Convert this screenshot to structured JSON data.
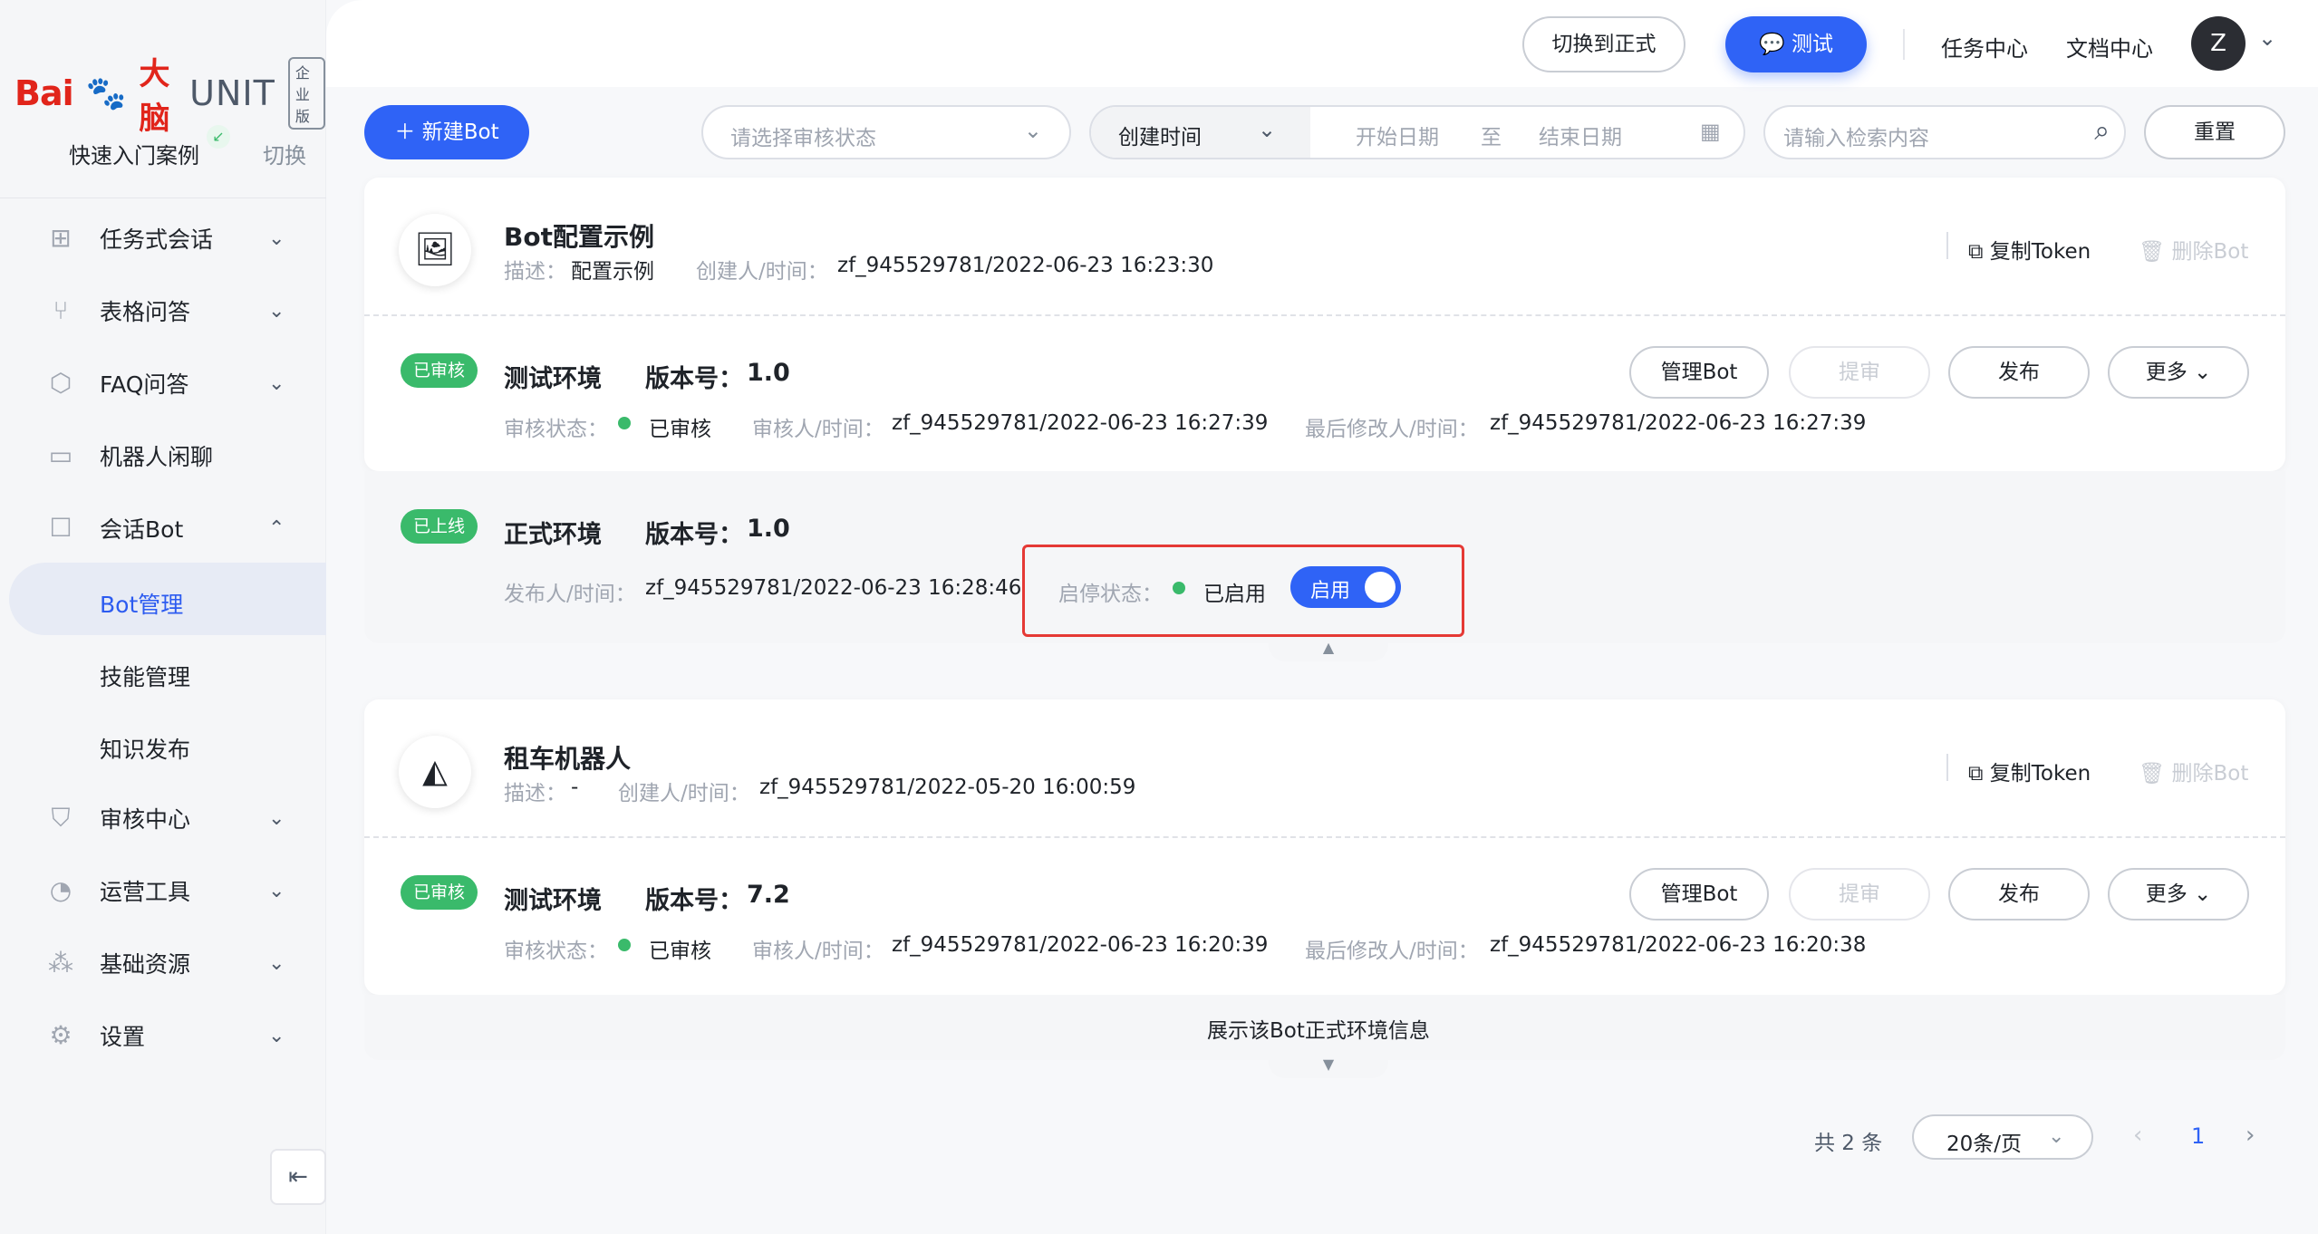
{
  "brand": {
    "bai": "Bai",
    "paw": "🐾",
    "brain": "大脑",
    "unit": "UNIT",
    "edition": "企业版"
  },
  "sidebar": {
    "quick_start": "快速入门案例",
    "switch": "切换",
    "items": [
      {
        "label": "任务式会话",
        "chevron": "⌄"
      },
      {
        "label": "表格问答",
        "chevron": "⌄"
      },
      {
        "label": "FAQ问答",
        "chevron": "⌄"
      },
      {
        "label": "机器人闲聊"
      },
      {
        "label": "会话Bot",
        "chevron": "⌃"
      },
      {
        "label": "审核中心",
        "chevron": "⌄"
      },
      {
        "label": "运营工具",
        "chevron": "⌄"
      },
      {
        "label": "基础资源",
        "chevron": "⌄"
      },
      {
        "label": "设置",
        "chevron": "⌄"
      }
    ],
    "subitems": [
      "Bot管理",
      "技能管理",
      "知识发布"
    ]
  },
  "header": {
    "switch_formal": "切换到正式",
    "test": "测试",
    "task_center": "任务中心",
    "doc_center": "文档中心",
    "avatar": "Z"
  },
  "toolbar": {
    "new_bot": "新建Bot",
    "status_placeholder": "请选择审核状态",
    "date_type": "创建时间",
    "start_date": "开始日期",
    "to": "至",
    "end_date": "结束日期",
    "search_placeholder": "请输入检索内容",
    "reset": "重置"
  },
  "labels": {
    "desc": "描述：",
    "creator_time": "创建人/时间：",
    "copy_token": "复制Token",
    "delete_bot": "删除Bot",
    "version": "版本号：",
    "review_status": "审核状态：",
    "reviewer_time": "审核人/时间：",
    "modifier_time": "最后修改人/时间：",
    "publisher_time": "发布人/时间：",
    "enable_status": "启停状态：",
    "manage": "管理Bot",
    "submit": "提审",
    "publish": "发布",
    "more": "更多"
  },
  "bots": [
    {
      "name": "Bot配置示例",
      "desc": "配置示例",
      "creator": "zf_945529781/2022-06-23 16:23:30",
      "test_env": {
        "tag": "已审核",
        "name": "测试环境",
        "version": "1.0",
        "status": "已审核",
        "reviewer": "zf_945529781/2022-06-23 16:27:39",
        "modifier": "zf_945529781/2022-06-23 16:27:39"
      },
      "prod_env": {
        "tag": "已上线",
        "name": "正式环境",
        "version": "1.0",
        "publisher": "zf_945529781/2022-06-23 16:28:46",
        "enable_status": "已启用",
        "toggle_label": "启用"
      }
    },
    {
      "name": "租车机器人",
      "desc": "-",
      "creator": "zf_945529781/2022-05-20 16:00:59",
      "test_env": {
        "tag": "已审核",
        "name": "测试环境",
        "version": "7.2",
        "status": "已审核",
        "reviewer": "zf_945529781/2022-06-23 16:20:39",
        "modifier": "zf_945529781/2022-06-23 16:20:38"
      },
      "expand_hint": "展示该Bot正式环境信息"
    }
  ],
  "pagination": {
    "total": "共 2 条",
    "page_size": "20条/页",
    "current": "1"
  },
  "colors": {
    "primary": "#2f63f6",
    "success": "#3aba6b",
    "highlight": "#e53935"
  }
}
